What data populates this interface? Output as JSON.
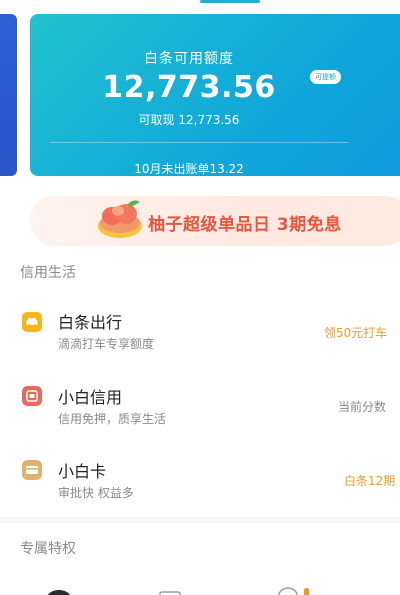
{
  "credit_card": {
    "title": "白条可用额度",
    "amount": "12,773.56",
    "badge": "可提额",
    "withdraw": "可取现 12,773.56",
    "bill": "10月未出账单13.22"
  },
  "promo": {
    "text": "柚子超级单品日 3期免息"
  },
  "sections": {
    "credit_life": "信用生活",
    "exclusive": "专属特权"
  },
  "items": [
    {
      "title": "白条出行",
      "subtitle": "滴滴打车专享额度",
      "tag": "领50元打车"
    },
    {
      "title": "小白信用",
      "subtitle": "信用免押，质享生活",
      "tag": "当前分数"
    },
    {
      "title": "小白卡",
      "subtitle": "审批快  权益多",
      "tag": "白条12期"
    }
  ],
  "colors": {
    "card_gradient_start": "#21c2cf",
    "card_gradient_end": "#0e9be0",
    "promo_text": "#e8553d",
    "tag_orange": "#f09a2a",
    "tag_grey": "#8a8a8a"
  }
}
